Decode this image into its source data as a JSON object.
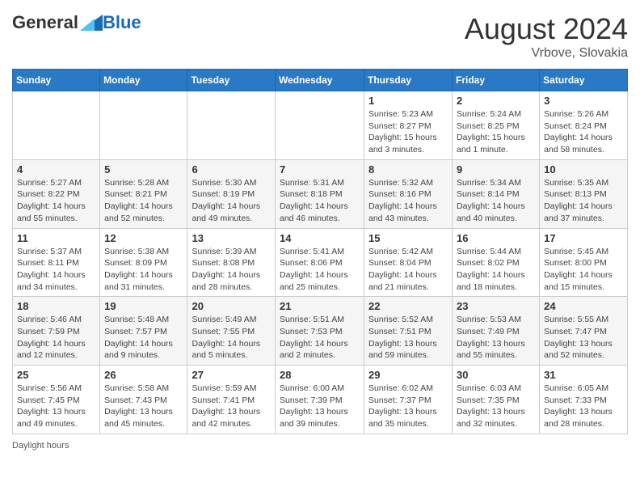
{
  "header": {
    "logo_general": "General",
    "logo_blue": "Blue",
    "month_year": "August 2024",
    "location": "Vrbove, Slovakia"
  },
  "weekdays": [
    "Sunday",
    "Monday",
    "Tuesday",
    "Wednesday",
    "Thursday",
    "Friday",
    "Saturday"
  ],
  "weeks": [
    [
      {
        "day": "",
        "info": ""
      },
      {
        "day": "",
        "info": ""
      },
      {
        "day": "",
        "info": ""
      },
      {
        "day": "",
        "info": ""
      },
      {
        "day": "1",
        "info": "Sunrise: 5:23 AM\nSunset: 8:27 PM\nDaylight: 15 hours and 3 minutes."
      },
      {
        "day": "2",
        "info": "Sunrise: 5:24 AM\nSunset: 8:25 PM\nDaylight: 15 hours and 1 minute."
      },
      {
        "day": "3",
        "info": "Sunrise: 5:26 AM\nSunset: 8:24 PM\nDaylight: 14 hours and 58 minutes."
      }
    ],
    [
      {
        "day": "4",
        "info": "Sunrise: 5:27 AM\nSunset: 8:22 PM\nDaylight: 14 hours and 55 minutes."
      },
      {
        "day": "5",
        "info": "Sunrise: 5:28 AM\nSunset: 8:21 PM\nDaylight: 14 hours and 52 minutes."
      },
      {
        "day": "6",
        "info": "Sunrise: 5:30 AM\nSunset: 8:19 PM\nDaylight: 14 hours and 49 minutes."
      },
      {
        "day": "7",
        "info": "Sunrise: 5:31 AM\nSunset: 8:18 PM\nDaylight: 14 hours and 46 minutes."
      },
      {
        "day": "8",
        "info": "Sunrise: 5:32 AM\nSunset: 8:16 PM\nDaylight: 14 hours and 43 minutes."
      },
      {
        "day": "9",
        "info": "Sunrise: 5:34 AM\nSunset: 8:14 PM\nDaylight: 14 hours and 40 minutes."
      },
      {
        "day": "10",
        "info": "Sunrise: 5:35 AM\nSunset: 8:13 PM\nDaylight: 14 hours and 37 minutes."
      }
    ],
    [
      {
        "day": "11",
        "info": "Sunrise: 5:37 AM\nSunset: 8:11 PM\nDaylight: 14 hours and 34 minutes."
      },
      {
        "day": "12",
        "info": "Sunrise: 5:38 AM\nSunset: 8:09 PM\nDaylight: 14 hours and 31 minutes."
      },
      {
        "day": "13",
        "info": "Sunrise: 5:39 AM\nSunset: 8:08 PM\nDaylight: 14 hours and 28 minutes."
      },
      {
        "day": "14",
        "info": "Sunrise: 5:41 AM\nSunset: 8:06 PM\nDaylight: 14 hours and 25 minutes."
      },
      {
        "day": "15",
        "info": "Sunrise: 5:42 AM\nSunset: 8:04 PM\nDaylight: 14 hours and 21 minutes."
      },
      {
        "day": "16",
        "info": "Sunrise: 5:44 AM\nSunset: 8:02 PM\nDaylight: 14 hours and 18 minutes."
      },
      {
        "day": "17",
        "info": "Sunrise: 5:45 AM\nSunset: 8:00 PM\nDaylight: 14 hours and 15 minutes."
      }
    ],
    [
      {
        "day": "18",
        "info": "Sunrise: 5:46 AM\nSunset: 7:59 PM\nDaylight: 14 hours and 12 minutes."
      },
      {
        "day": "19",
        "info": "Sunrise: 5:48 AM\nSunset: 7:57 PM\nDaylight: 14 hours and 9 minutes."
      },
      {
        "day": "20",
        "info": "Sunrise: 5:49 AM\nSunset: 7:55 PM\nDaylight: 14 hours and 5 minutes."
      },
      {
        "day": "21",
        "info": "Sunrise: 5:51 AM\nSunset: 7:53 PM\nDaylight: 14 hours and 2 minutes."
      },
      {
        "day": "22",
        "info": "Sunrise: 5:52 AM\nSunset: 7:51 PM\nDaylight: 13 hours and 59 minutes."
      },
      {
        "day": "23",
        "info": "Sunrise: 5:53 AM\nSunset: 7:49 PM\nDaylight: 13 hours and 55 minutes."
      },
      {
        "day": "24",
        "info": "Sunrise: 5:55 AM\nSunset: 7:47 PM\nDaylight: 13 hours and 52 minutes."
      }
    ],
    [
      {
        "day": "25",
        "info": "Sunrise: 5:56 AM\nSunset: 7:45 PM\nDaylight: 13 hours and 49 minutes."
      },
      {
        "day": "26",
        "info": "Sunrise: 5:58 AM\nSunset: 7:43 PM\nDaylight: 13 hours and 45 minutes."
      },
      {
        "day": "27",
        "info": "Sunrise: 5:59 AM\nSunset: 7:41 PM\nDaylight: 13 hours and 42 minutes."
      },
      {
        "day": "28",
        "info": "Sunrise: 6:00 AM\nSunset: 7:39 PM\nDaylight: 13 hours and 39 minutes."
      },
      {
        "day": "29",
        "info": "Sunrise: 6:02 AM\nSunset: 7:37 PM\nDaylight: 13 hours and 35 minutes."
      },
      {
        "day": "30",
        "info": "Sunrise: 6:03 AM\nSunset: 7:35 PM\nDaylight: 13 hours and 32 minutes."
      },
      {
        "day": "31",
        "info": "Sunrise: 6:05 AM\nSunset: 7:33 PM\nDaylight: 13 hours and 28 minutes."
      }
    ]
  ],
  "footer": {
    "daylight_label": "Daylight hours"
  }
}
